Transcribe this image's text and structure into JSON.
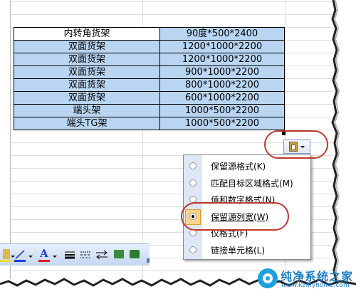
{
  "table": {
    "rows": [
      [
        "内转角货架",
        "90度*500*2400"
      ],
      [
        "双面货架",
        "1200*1000*2200"
      ],
      [
        "双面货架",
        "1200*1000*2200"
      ],
      [
        "双面货架",
        "900*1000*2200"
      ],
      [
        "双面货架",
        "800*1000*2200"
      ],
      [
        "双面货架",
        "600*1000*2200"
      ],
      [
        "端头架",
        "1000*500*2200"
      ],
      [
        "端头TG架",
        "1000*500*2200"
      ]
    ]
  },
  "paste_button": {
    "icon": "clipboard-icon",
    "dropdown_icon": "chevron-down-icon"
  },
  "paste_menu": {
    "items": [
      {
        "label": "保留源格式(K)",
        "selected": false
      },
      {
        "label": "匹配目标区域格式(M)",
        "selected": false
      },
      {
        "label": "值和数字格式(N)",
        "selected": false
      },
      {
        "label": "保留源列宽(W)",
        "selected": true
      },
      {
        "label": "仅格式(F)",
        "selected": false
      },
      {
        "label": "链接单元格(L)",
        "selected": false
      }
    ]
  },
  "toolbar": {
    "icons": [
      "fill-color-icon",
      "line-color-icon",
      "font-color-icon",
      "line-style-icon",
      "dash-style-icon",
      "arrow-style-icon",
      "shadow-icon",
      "3d-icon"
    ],
    "font_color_label": "A"
  },
  "colors": {
    "selection": "#b9d5f2",
    "highlight_ring": "#c0392b",
    "menu_highlight": "#ffd48a"
  },
  "watermark": {
    "title": "纯净系统之家",
    "url": "www.kzmyhome.com"
  }
}
